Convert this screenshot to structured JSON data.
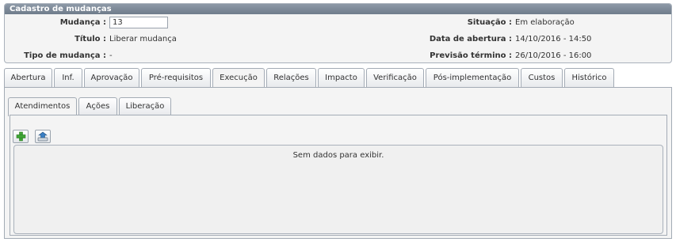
{
  "panel": {
    "title": "Cadastro de mudanças",
    "fields": {
      "mudanca_label": "Mudança :",
      "mudanca_value": "13",
      "titulo_label": "Título :",
      "titulo_value": "Liberar mudança",
      "tipo_label": "Tipo de mudança :",
      "tipo_value": "-",
      "situacao_label": "Situação :",
      "situacao_value": "Em elaboração",
      "abertura_label": "Data de abertura :",
      "abertura_value": "14/10/2016 - 14:50",
      "previsao_label": "Previsão término :",
      "previsao_value": "26/10/2016 - 16:00"
    }
  },
  "tabs": [
    {
      "label": "Abertura"
    },
    {
      "label": "Inf."
    },
    {
      "label": "Aprovação"
    },
    {
      "label": "Pré-requisitos"
    },
    {
      "label": "Execução"
    },
    {
      "label": "Relações"
    },
    {
      "label": "Impacto"
    },
    {
      "label": "Verificação"
    },
    {
      "label": "Pós-implementação"
    },
    {
      "label": "Custos"
    },
    {
      "label": "Histórico"
    }
  ],
  "active_tab": "Execução",
  "subtabs": [
    {
      "label": "Atendimentos"
    },
    {
      "label": "Ações"
    },
    {
      "label": "Liberação"
    }
  ],
  "active_subtab": "Atendimentos",
  "toolbar": {
    "add_icon": "plus-icon",
    "export_icon": "export-icon"
  },
  "grid": {
    "empty_text": "Sem dados para exibir."
  },
  "colors": {
    "title_bar": "#7b8795",
    "add_icon": "#3fa535",
    "export_icon": "#3a7fc4"
  }
}
